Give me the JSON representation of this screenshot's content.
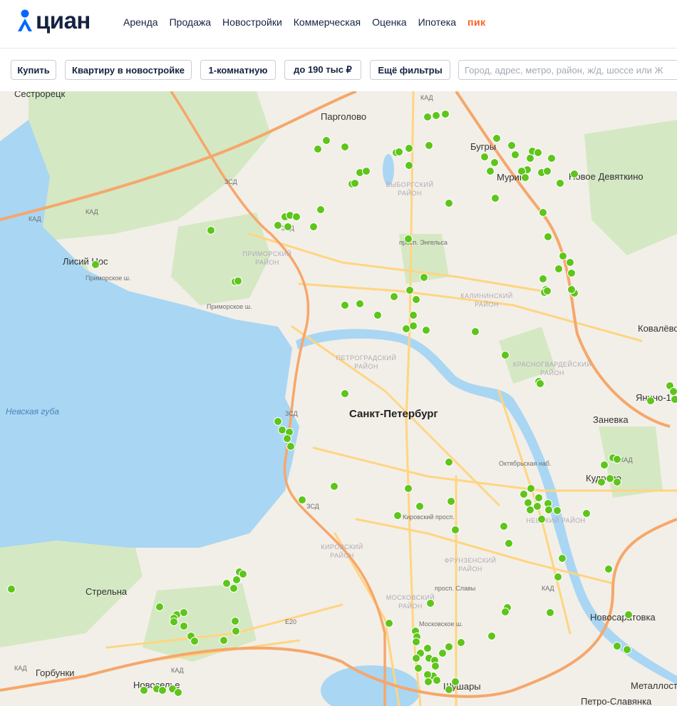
{
  "header": {
    "logo_text": "циан",
    "nav": [
      "Аренда",
      "Продажа",
      "Новостройки",
      "Коммерческая",
      "Оценка",
      "Ипотека"
    ],
    "brand_link": "пик"
  },
  "filters": {
    "deal": "Купить",
    "object_type": "Квартиру в новостройке",
    "rooms": "1-комнатную",
    "price": "до 190 тыс ₽",
    "more": "Ещё фильтры",
    "search_placeholder": "Город, адрес, метро, район, ж/д, шоссе или Ж"
  },
  "map": {
    "city_label": "Санкт-Петербург",
    "places": [
      {
        "name": "Сестрорецк"
      },
      {
        "name": "Парголово"
      },
      {
        "name": "Бугры"
      },
      {
        "name": "Мурино"
      },
      {
        "name": "Новое Девяткино"
      },
      {
        "name": "Лисий Нос"
      },
      {
        "name": "Ковалёво"
      },
      {
        "name": "Янино-1"
      },
      {
        "name": "Заневка"
      },
      {
        "name": "Кудрово"
      },
      {
        "name": "Стрельна"
      },
      {
        "name": "Горбунки"
      },
      {
        "name": "Новоселье"
      },
      {
        "name": "Шушары"
      },
      {
        "name": "Новосаратовка"
      },
      {
        "name": "Металлострой"
      },
      {
        "name": "Петро-Славянка"
      }
    ],
    "districts": [
      {
        "name": "ВЫБОРГСКИЙ\nРАЙОН"
      },
      {
        "name": "ПРИМОРСКИЙ\nРАЙОН"
      },
      {
        "name": "КАЛИНИНСКИЙ\nРАЙОН"
      },
      {
        "name": "ПЕТРОГРАДСКИЙ\nРАЙОН"
      },
      {
        "name": "КРАСНОГВАРДЕЙСКИЙ\nРАЙОН"
      },
      {
        "name": "НЕВСКИЙ РАЙОН"
      },
      {
        "name": "КИРОВСКИЙ\nРАЙОН"
      },
      {
        "name": "ФРУНЗЕНСКИЙ\nРАЙОН"
      },
      {
        "name": "МОСКОВСКИЙ\nРАЙОН"
      }
    ],
    "water_label": "Невская губа",
    "road_labels": [
      "КАД",
      "ЗСД",
      "Приморское ш.",
      "просп. Энгельса",
      "Октябрьская наб.",
      "Кировский просп.",
      "Московское ш.",
      "просп. Славы",
      "Е20"
    ],
    "colors": {
      "marker": "#5ec51a",
      "water": "#a9d6f3",
      "land": "#f2efe8",
      "park": "#d5e8c4",
      "road": "#ffd580",
      "kad": "#f6a76b"
    }
  }
}
